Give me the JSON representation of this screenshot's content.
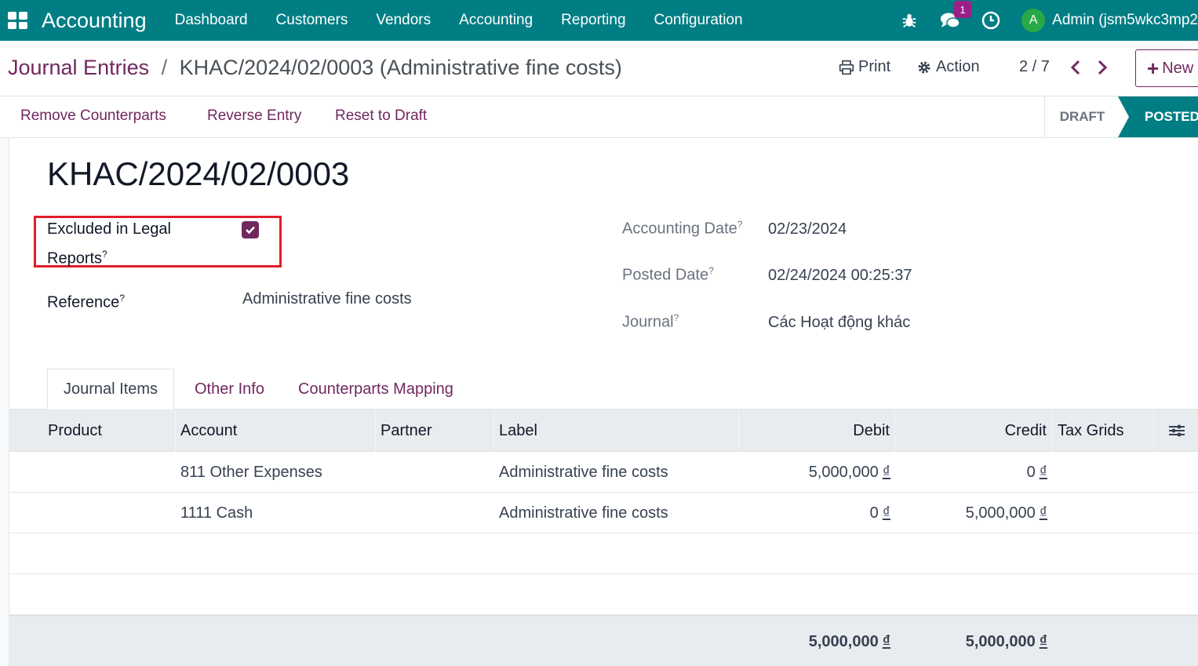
{
  "navbar": {
    "app_name": "Accounting",
    "menu": [
      "Dashboard",
      "Customers",
      "Vendors",
      "Accounting",
      "Reporting",
      "Configuration"
    ],
    "messages_count": "1",
    "avatar_initial": "A",
    "user_name": "Admin (jsm5wkc3mp2"
  },
  "breadcrumb": {
    "parent": "Journal Entries",
    "separator": "/",
    "current": "KHAC/2024/02/0003 (Administrative fine costs)"
  },
  "control_panel": {
    "print_label": "Print",
    "action_label": "Action",
    "pager": "2 / 7",
    "new_label": "New"
  },
  "status_bar": {
    "buttons": [
      "Remove Counterparts",
      "Reverse Entry",
      "Reset to Draft"
    ],
    "stages": [
      "DRAFT",
      "POSTED"
    ],
    "active_stage": "POSTED"
  },
  "form": {
    "title": "KHAC/2024/02/0003",
    "excluded_label_line1": "Excluded in Legal",
    "excluded_label_line2": "Reports",
    "excluded_checked": true,
    "reference_label": "Reference",
    "reference_value": "Administrative fine costs",
    "accounting_date_label": "Accounting Date",
    "accounting_date_value": "02/23/2024",
    "posted_date_label": "Posted Date",
    "posted_date_value": "02/24/2024 00:25:37",
    "journal_label": "Journal",
    "journal_value": "Các Hoạt động khác",
    "help_mark": "?"
  },
  "tabs": [
    "Journal Items",
    "Other Info",
    "Counterparts Mapping"
  ],
  "table": {
    "columns": [
      "Product",
      "Account",
      "Partner",
      "Label",
      "Debit",
      "Credit",
      "Tax Grids"
    ],
    "currency": "₫",
    "rows": [
      {
        "product": "",
        "account": "811 Other Expenses",
        "partner": "",
        "label": "Administrative fine costs",
        "debit": "5,000,000",
        "credit": "0",
        "tax_grids": ""
      },
      {
        "product": "",
        "account": "1111 Cash",
        "partner": "",
        "label": "Administrative fine costs",
        "debit": "0",
        "credit": "5,000,000",
        "tax_grids": ""
      }
    ],
    "total_debit": "5,000,000",
    "total_credit": "5,000,000"
  },
  "colors": {
    "navbar": "#017e84",
    "brand": "#71285f",
    "highlight": "#e11d2b"
  }
}
